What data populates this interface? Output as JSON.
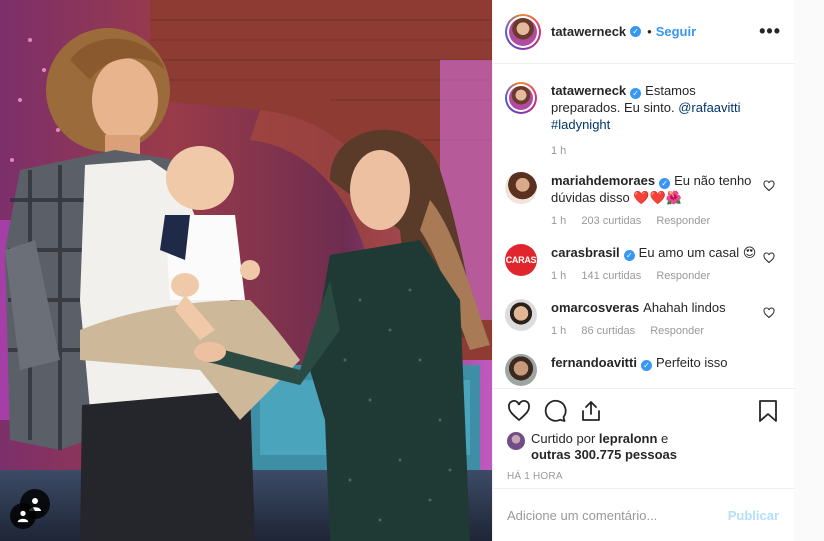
{
  "post": {
    "username": "tatawerneck",
    "follow_label": "Seguir",
    "more_label": "•••",
    "caption": {
      "text": "Estamos preparados. Eu sinto. ",
      "mention": "@rafaavitti",
      "hashtag": "#ladynight",
      "time": "1 h"
    }
  },
  "comments": [
    {
      "username": "mariahdemoraes",
      "text": "Eu não tenho dúvidas disso ❤️❤️🌺",
      "time": "1 h",
      "likes": "203 curtidas",
      "reply": "Responder"
    },
    {
      "username": "carasbrasil",
      "text": "Eu amo um casal 😍",
      "time": "1 h",
      "likes": "141 curtidas",
      "reply": "Responder"
    },
    {
      "username": "omarcosveras",
      "text": "Ahahah lindos",
      "time": "1 h",
      "likes": "86 curtidas",
      "reply": "Responder"
    },
    {
      "username": "fernandoavitti",
      "text": "Perfeito isso",
      "time": "",
      "likes": "",
      "reply": ""
    }
  ],
  "likes": {
    "prefix": "Curtido por ",
    "user": "lepralonn",
    "middle": " e",
    "others": "outras 300.775 pessoas"
  },
  "timestamp": "HÁ 1 HORA",
  "add_comment": {
    "placeholder": "Adicione um comentário...",
    "publish_label": "Publicar"
  },
  "colors": {
    "accent": "#3897f0",
    "publish_disabled": "#b2dffc",
    "heart_red": "#ed4956"
  },
  "icons": [
    "more-icon",
    "heart-icon",
    "comment-icon",
    "share-icon",
    "bookmark-icon",
    "verified-icon",
    "user-tag-icon"
  ]
}
